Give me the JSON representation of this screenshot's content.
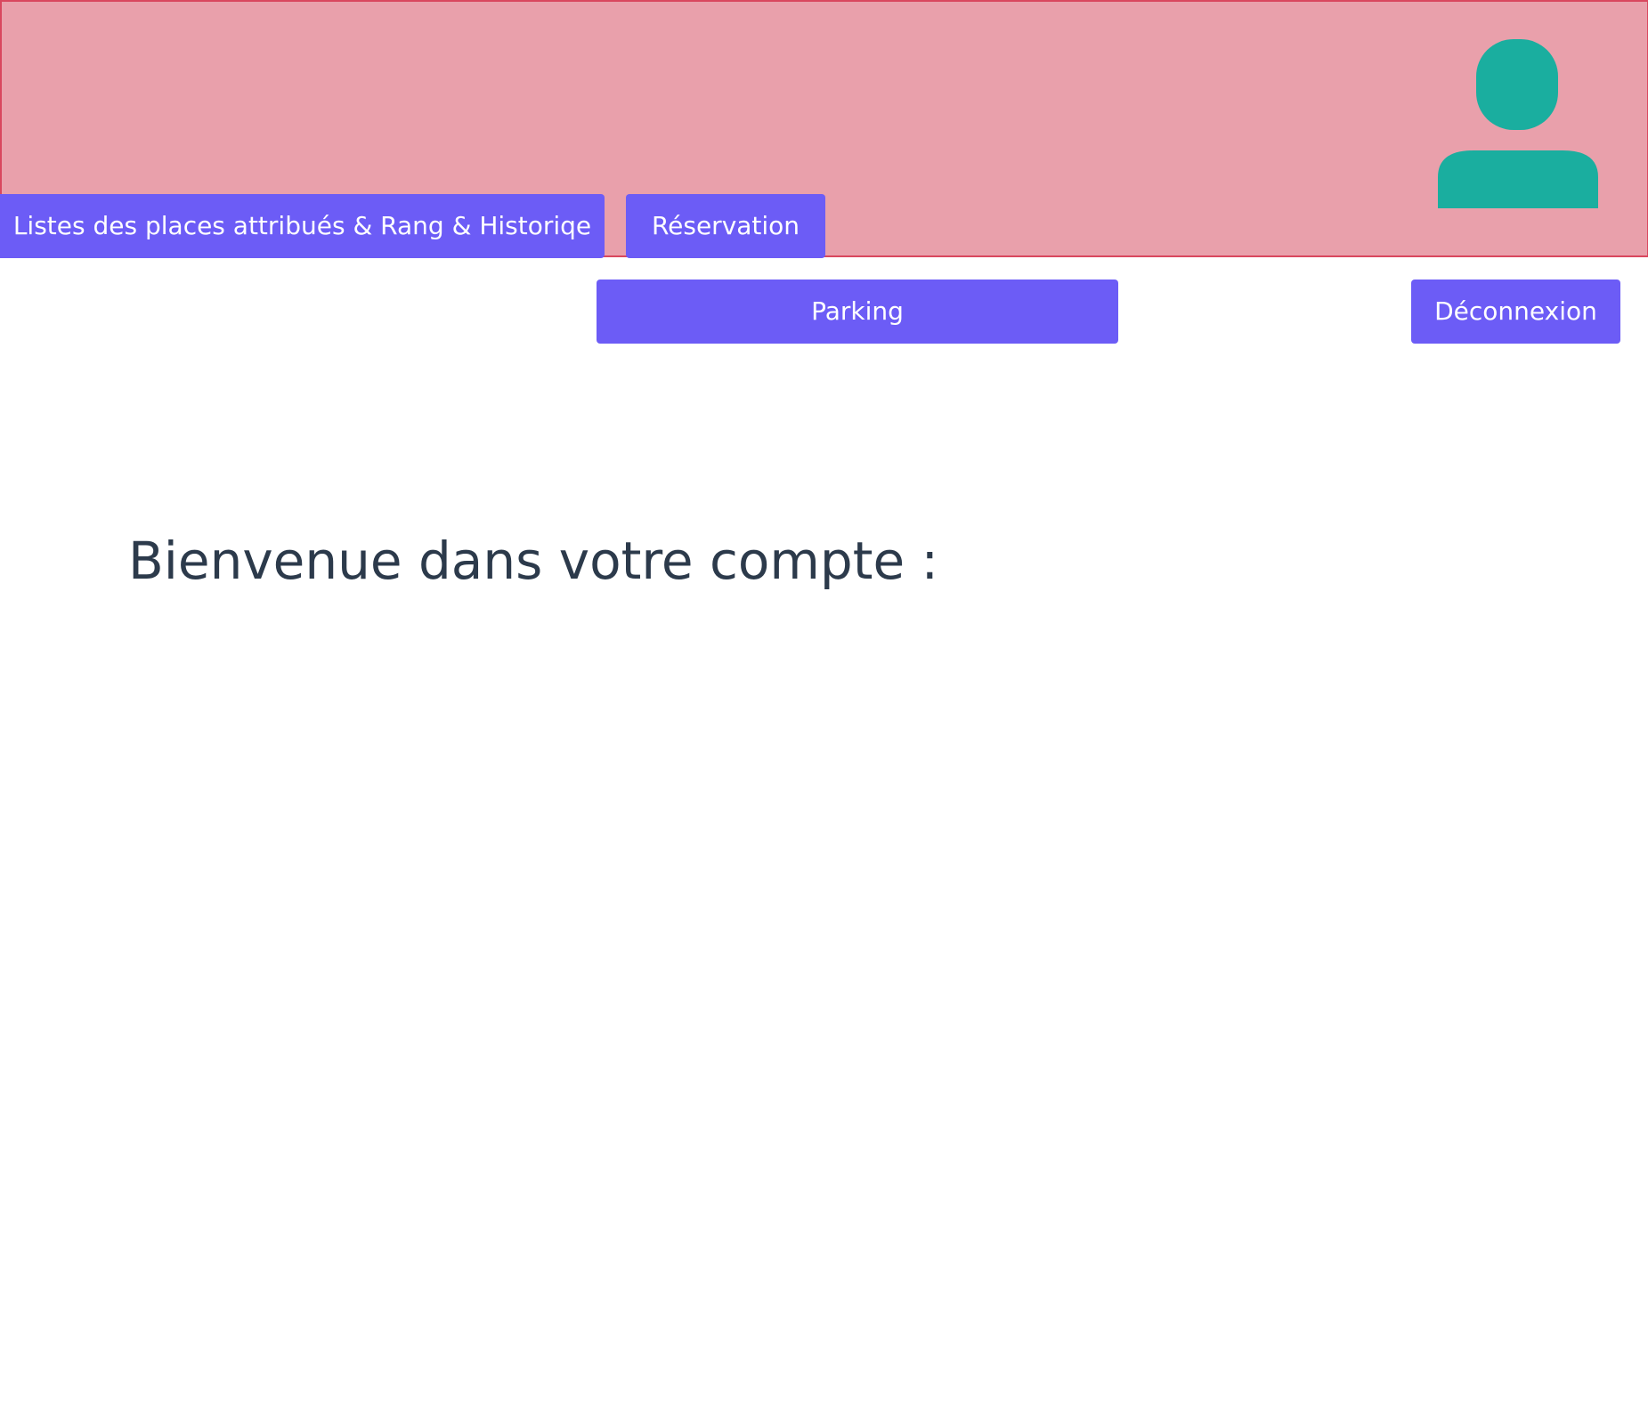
{
  "header": {
    "background_color": "#e9a0ab",
    "avatar_icon": "user-icon",
    "avatar_color": "#1aae9f"
  },
  "nav": {
    "places_label": "Listes des places attribués & Rang & Historiqe",
    "reservation_label": "Réservation",
    "parking_label": "Parking",
    "logout_label": "Déconnexion",
    "button_color": "#6c5cf6"
  },
  "main": {
    "welcome_text": "Bienvenue dans votre compte :"
  }
}
